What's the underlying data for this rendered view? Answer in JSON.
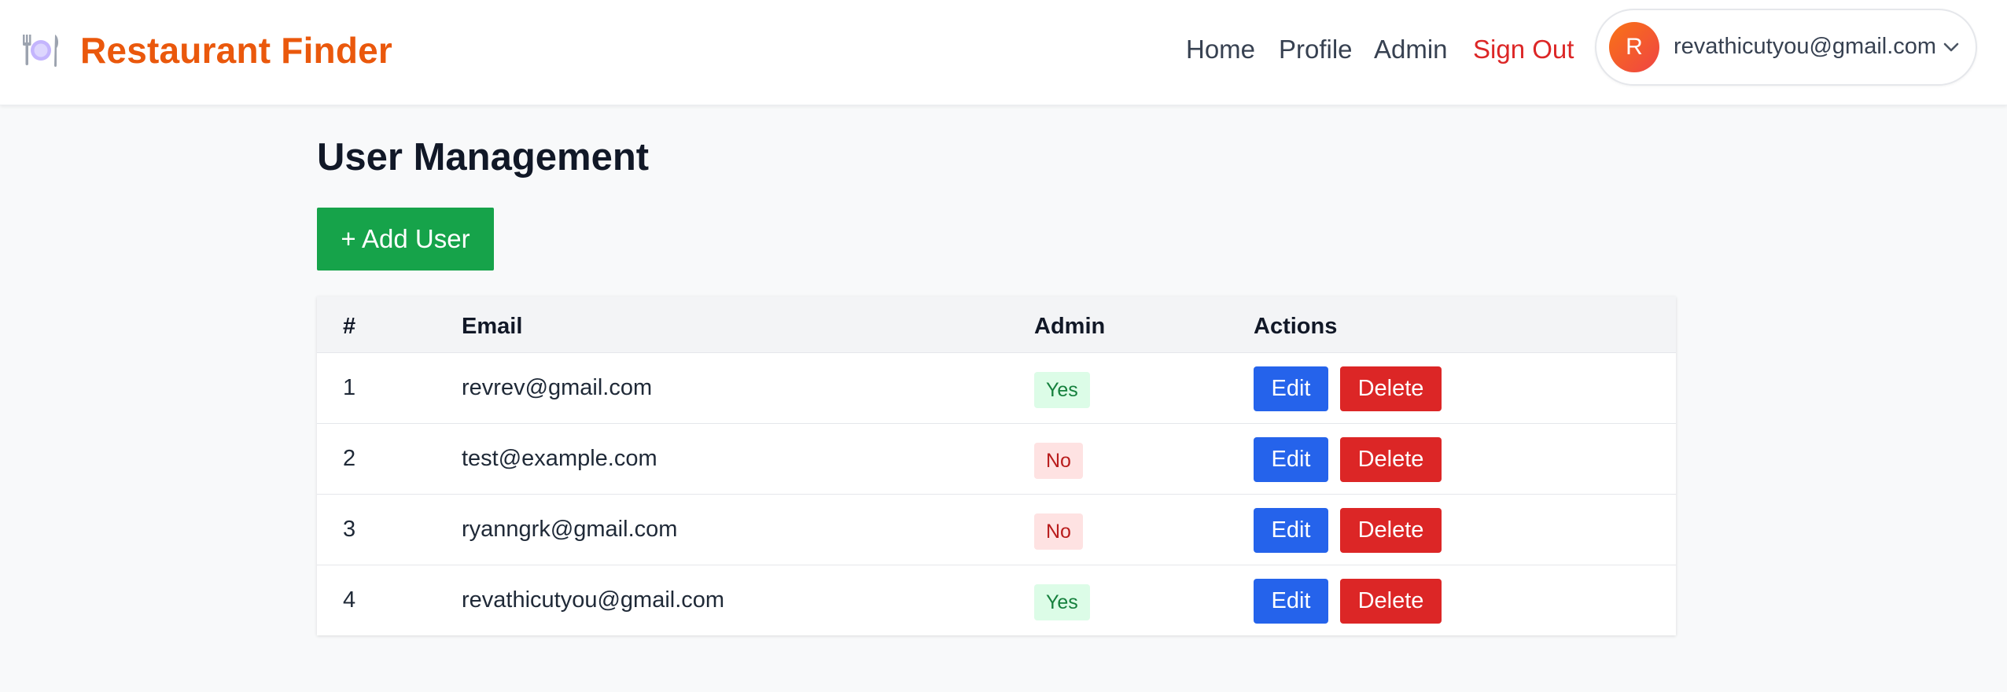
{
  "header": {
    "brand_icon": "plate-cutlery-icon",
    "brand_title": "Restaurant Finder",
    "nav": [
      {
        "label": "Home"
      },
      {
        "label": "Profile"
      },
      {
        "label": "Admin"
      },
      {
        "label": "Sign Out"
      }
    ],
    "user": {
      "avatar_letter": "R",
      "email": "revathicutyou@gmail.com",
      "menu_icon": "chevron-down-icon"
    }
  },
  "main": {
    "title": "User Management",
    "add_button": "+ Add User",
    "table": {
      "columns": [
        "#",
        "Email",
        "Admin",
        "Actions"
      ],
      "rows": [
        {
          "num": "1",
          "email": "revrev@gmail.com",
          "admin": "Yes",
          "edit": "Edit",
          "delete": "Delete"
        },
        {
          "num": "2",
          "email": "test@example.com",
          "admin": "No",
          "edit": "Edit",
          "delete": "Delete"
        },
        {
          "num": "3",
          "email": "ryanngrk@gmail.com",
          "admin": "No",
          "edit": "Edit",
          "delete": "Delete"
        },
        {
          "num": "4",
          "email": "revathicutyou@gmail.com",
          "admin": "Yes",
          "edit": "Edit",
          "delete": "Delete"
        }
      ]
    }
  },
  "colors": {
    "brand": "#ea580c",
    "signout": "#dc2626",
    "add_button": "#16a34a",
    "edit_button": "#2563eb",
    "delete_button": "#dc2626",
    "badge_yes_bg": "#dcfce7",
    "badge_no_bg": "#fee2e2"
  }
}
